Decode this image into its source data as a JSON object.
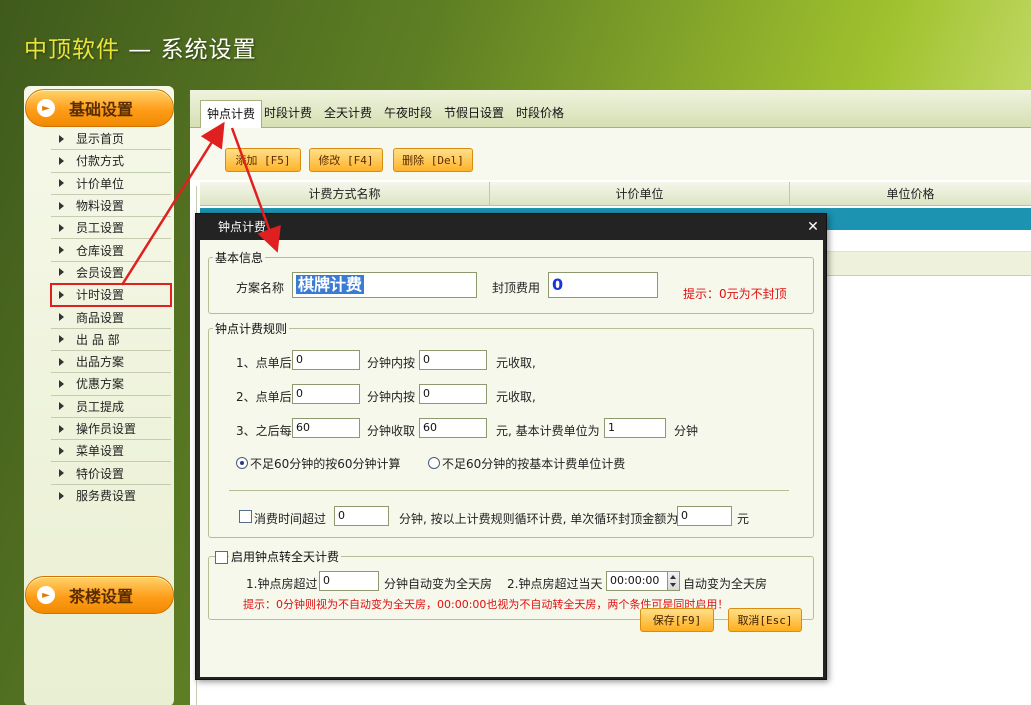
{
  "app": {
    "brand": "中顶软件",
    "title": " — 系统设置"
  },
  "sidebar": {
    "section1": "基础设置",
    "section2": "茶楼设置",
    "items": [
      {
        "label": "显示首页"
      },
      {
        "label": "付款方式"
      },
      {
        "label": "计价单位"
      },
      {
        "label": "物料设置"
      },
      {
        "label": "员工设置"
      },
      {
        "label": "仓库设置"
      },
      {
        "label": "会员设置"
      },
      {
        "label": "计时设置"
      },
      {
        "label": "商品设置"
      },
      {
        "label": "出 品 部"
      },
      {
        "label": "出品方案"
      },
      {
        "label": "优惠方案"
      },
      {
        "label": "员工提成"
      },
      {
        "label": "操作员设置"
      },
      {
        "label": "菜单设置"
      },
      {
        "label": "特价设置"
      },
      {
        "label": "服务费设置"
      }
    ]
  },
  "tabs": [
    "钟点计费",
    "时段计费",
    "全天计费",
    "午夜时段",
    "节假日设置",
    "时段价格"
  ],
  "toolbar": {
    "add": "添加 [F5]",
    "edit": "修改 [F4]",
    "delete": "删除 [Del]"
  },
  "grid": {
    "columns": [
      "计费方式名称",
      "计价单位",
      "单位价格"
    ]
  },
  "dialog": {
    "title": "钟点计费",
    "basic": {
      "legend": "基本信息",
      "name_label": "方案名称",
      "name_value": "棋牌计费",
      "cap_label": "封顶费用",
      "cap_value": "0",
      "hint": "提示：0元为不封顶"
    },
    "rules": {
      "legend": "钟点计费规则",
      "r1_prefix": "1、点单后",
      "r1_v1": "0",
      "r1_mid": "分钟内按",
      "r1_v2": "0",
      "r1_suffix": "元收取,",
      "r2_prefix": "2、点单后",
      "r2_v1": "0",
      "r2_mid": "分钟内按",
      "r2_v2": "0",
      "r2_suffix": "元收取,",
      "r3_prefix": "3、之后每",
      "r3_v1": "60",
      "r3_mid": "分钟收取",
      "r3_v2": "60",
      "r3_suffix": "元, 基本计费单位为",
      "r3_v3": "1",
      "r3_unit": "分钟",
      "radio1": "不足60分钟的按60分钟计算",
      "radio2": "不足60分钟的按基本计费单位计费",
      "loop_prefix": "消费时间超过",
      "loop_v1": "0",
      "loop_mid": "分钟, 按以上计费规则循环计费, 单次循环封顶金额为",
      "loop_v2": "0",
      "loop_unit": "元"
    },
    "fullday": {
      "legend": "启用钟点转全天计费",
      "c1_prefix": "1.钟点房超过",
      "c1_value": "0",
      "c1_suffix": "分钟自动变为全天房",
      "c2_prefix": "2.钟点房超过当天",
      "c2_value": "00:00:00",
      "c2_suffix": "自动变为全天房",
      "hint": "提示：0分钟则视为不自动变为全天房，00:00:00也视为不自动转全天房，两个条件可是同时启用！"
    },
    "save": "保存[F9]",
    "cancel": "取消[Esc]"
  },
  "colors": {
    "accent_orange": "#ff9d1a",
    "selected_row": "#1c93b0",
    "annotation_red": "#e02020",
    "hint_red": "#e01010"
  }
}
